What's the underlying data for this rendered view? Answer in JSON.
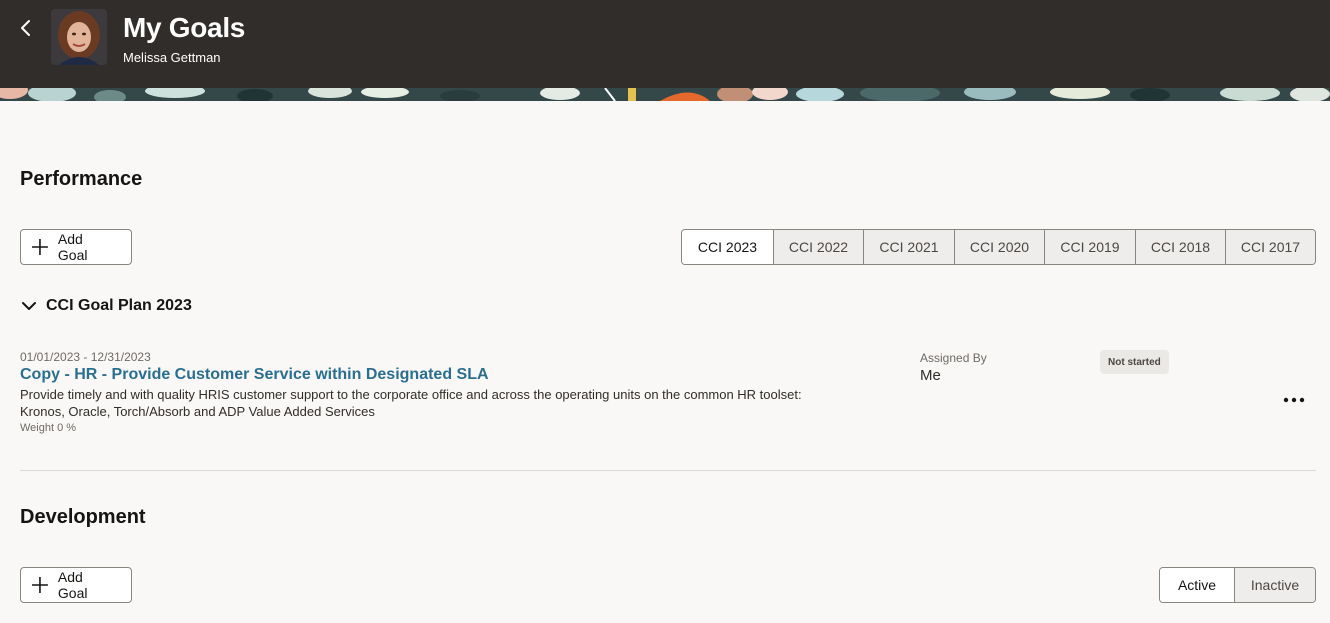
{
  "header": {
    "back_icon": "chevron-left-icon",
    "title": "My Goals",
    "subtitle": "Melissa Gettman",
    "background": "#312d2a"
  },
  "performance": {
    "title": "Performance",
    "add_goal_label": "Add Goal",
    "years": [
      "CCI 2023",
      "CCI 2022",
      "CCI 2021",
      "CCI 2020",
      "CCI 2019",
      "CCI 2018",
      "CCI 2017"
    ],
    "selected_year": "CCI 2023",
    "plan_title": "CCI Goal Plan 2023",
    "goal": {
      "dates": "01/01/2023 - 12/31/2023",
      "title": "Copy - HR - Provide Customer Service within Designated SLA",
      "description_line1": "Provide timely and with quality HRIS customer support to the corporate office and across the operating units on the common HR toolset:",
      "description_line2": "Kronos, Oracle, Torch/Absorb and ADP Value Added Services",
      "weight": "Weight 0 %",
      "assigned_by_label": "Assigned By",
      "assigned_by_value": "Me",
      "status": "Not started",
      "link_color": "#2a6f91"
    }
  },
  "development": {
    "title": "Development",
    "add_goal_label": "Add Goal",
    "filters": [
      "Active",
      "Inactive"
    ],
    "selected_filter": "Active"
  }
}
